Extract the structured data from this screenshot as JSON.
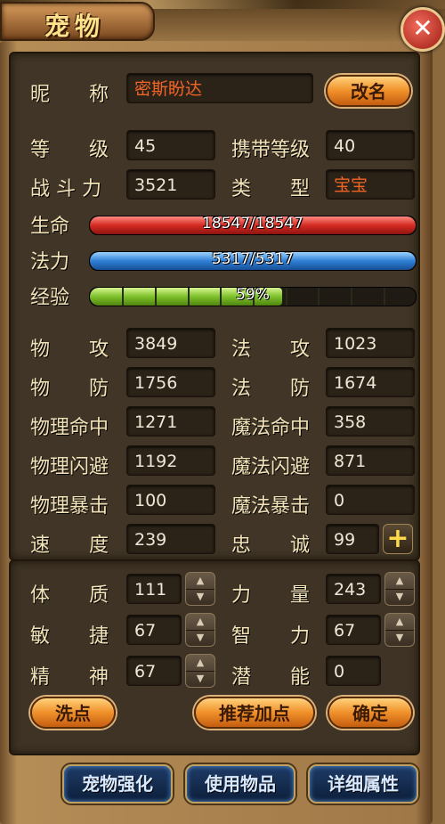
{
  "window": {
    "title": "宠物",
    "close_icon": "close-icon"
  },
  "nickname": {
    "label": "昵　　称",
    "value": "密斯盼达",
    "rename_label": "改名"
  },
  "basic": {
    "level_label": "等　　级",
    "level": "45",
    "carry_label": "携带等级",
    "carry": "40",
    "power_label": "战 斗 力",
    "power": "3521",
    "type_label": "类　　型",
    "type": "宝宝"
  },
  "bars": {
    "hp_label": "生命",
    "hp_text": "18547/18547",
    "hp_fraction": 1.0,
    "mp_label": "法力",
    "mp_text": "5317/5317",
    "mp_fraction": 1.0,
    "exp_label": "经验",
    "exp_text": "59%",
    "exp_fraction": 0.59
  },
  "stats": [
    {
      "l_label": "物　　攻",
      "l_value": "3849",
      "r_label": "法　　攻",
      "r_value": "1023"
    },
    {
      "l_label": "物　　防",
      "l_value": "1756",
      "r_label": "法　　防",
      "r_value": "1674"
    },
    {
      "l_label": "物理命中",
      "l_value": "1271",
      "r_label": "魔法命中",
      "r_value": "358"
    },
    {
      "l_label": "物理闪避",
      "l_value": "1192",
      "r_label": "魔法闪避",
      "r_value": "871"
    },
    {
      "l_label": "物理暴击",
      "l_value": "100",
      "r_label": "魔法暴击",
      "r_value": "0"
    },
    {
      "l_label": "速　　度",
      "l_value": "239",
      "r_label": "忠　　诚",
      "r_value": "99"
    }
  ],
  "attributes": [
    {
      "l_label": "体　　质",
      "l_value": "111",
      "r_label": "力　　量",
      "r_value": "243"
    },
    {
      "l_label": "敏　　捷",
      "l_value": "67",
      "r_label": "智　　力",
      "r_value": "67"
    },
    {
      "l_label": "精　　神",
      "l_value": "67",
      "r_label": "潜　　能",
      "r_value": "0"
    }
  ],
  "buttons": {
    "reset": "洗点",
    "recommend": "推荐加点",
    "confirm": "确定",
    "enhance": "宠物强化",
    "use_item": "使用物品",
    "details": "详细属性",
    "plus": "+"
  },
  "colors": {
    "hp": "#d42a22",
    "mp": "#2f7fd6",
    "exp": "#7dc12a",
    "accent": "#f0902a"
  }
}
